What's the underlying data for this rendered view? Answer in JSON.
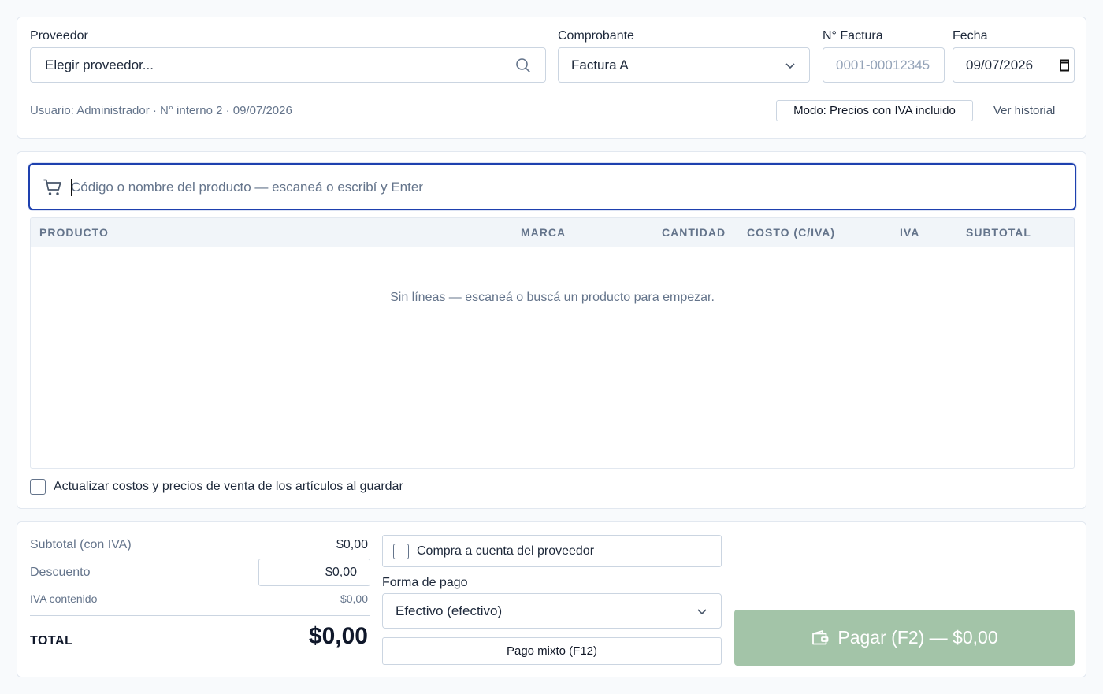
{
  "header": {
    "proveedor_label": "Proveedor",
    "proveedor_value": "Elegir proveedor...",
    "comprobante_label": "Comprobante",
    "comprobante_value": "Factura A",
    "factura_label": "N° Factura",
    "factura_placeholder": "0001-00012345",
    "fecha_label": "Fecha",
    "fecha_value": "09/07/2026",
    "info_line": "Usuario: Administrador · N° interno 2 · 09/07/2026",
    "mode_badge": "Modo: Precios con IVA incluido",
    "history_link": "Ver historial"
  },
  "search": {
    "placeholder": "Código o nombre del producto — escaneá o escribí y Enter"
  },
  "table": {
    "columns": [
      "PRODUCTO",
      "MARCA",
      "CANTIDAD",
      "COSTO (C/IVA)",
      "IVA",
      "SUBTOTAL"
    ],
    "empty_message": "Sin líneas — escaneá o buscá un producto para empezar."
  },
  "update_costs_label": "Actualizar costos y precios de venta de los artículos al guardar",
  "totals": {
    "subtotal_label": "Subtotal (con IVA)",
    "subtotal_value": "$0,00",
    "descuento_label": "Descuento",
    "descuento_value": "$0,00",
    "iva_label": "IVA contenido",
    "iva_value": "$0,00",
    "total_label": "TOTAL",
    "total_value": "$0,00"
  },
  "payment": {
    "cuenta_label": "Compra a cuenta del proveedor",
    "forma_label": "Forma de pago",
    "forma_value": "Efectivo (efectivo)",
    "mixto_label": "Pago mixto (F12)",
    "pay_button": "Pagar (F2) — $0,00"
  },
  "colors": {
    "accent": "#1e40af",
    "pay_button_bg": "#a3c4a8"
  }
}
